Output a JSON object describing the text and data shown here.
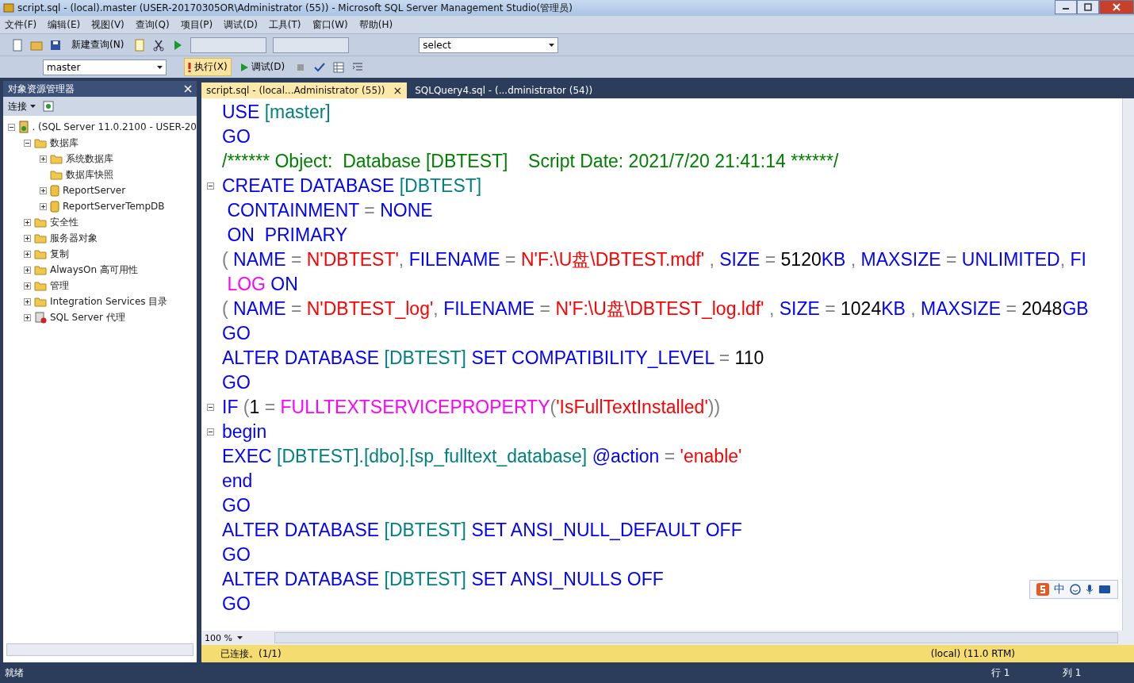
{
  "window": {
    "title": "script.sql - (local).master (USER-20170305OR\\Administrator (55)) - Microsoft SQL Server Management Studio(管理员)"
  },
  "menu": [
    "文件(F)",
    "编辑(E)",
    "视图(V)",
    "查询(Q)",
    "项目(P)",
    "调试(D)",
    "工具(T)",
    "窗口(W)",
    "帮助(H)"
  ],
  "toolbar": {
    "new_query": "新建查询(N)",
    "database": "master",
    "execute": "执行(X)",
    "debug": "调试(D)",
    "search_combo": "select"
  },
  "object_explorer": {
    "title": "对象资源管理器",
    "connect": "连接",
    "tree": [
      {
        "label": ". (SQL Server 11.0.2100 - USER-20",
        "kind": "server",
        "expanded": true,
        "children": [
          {
            "label": "数据库",
            "kind": "folder",
            "expanded": true,
            "children": [
              {
                "label": "系统数据库",
                "kind": "folder",
                "expanded": false
              },
              {
                "label": "数据库快照",
                "kind": "folder"
              },
              {
                "label": "ReportServer",
                "kind": "database",
                "expanded": false
              },
              {
                "label": "ReportServerTempDB",
                "kind": "database",
                "expanded": false
              }
            ]
          },
          {
            "label": "安全性",
            "kind": "folder",
            "expanded": false
          },
          {
            "label": "服务器对象",
            "kind": "folder",
            "expanded": false
          },
          {
            "label": "复制",
            "kind": "folder",
            "expanded": false
          },
          {
            "label": "AlwaysOn 高可用性",
            "kind": "folder",
            "expanded": false
          },
          {
            "label": "管理",
            "kind": "folder",
            "expanded": false
          },
          {
            "label": "Integration Services 目录",
            "kind": "folder",
            "expanded": false
          },
          {
            "label": "SQL Server 代理",
            "kind": "agent",
            "expanded": false
          }
        ]
      }
    ]
  },
  "tabs": [
    {
      "label": "script.sql - (local...Administrator (55))",
      "selected": true,
      "close": "×"
    },
    {
      "label": "SQLQuery4.sql - (...dministrator (54))",
      "selected": false
    }
  ],
  "code": [
    {
      "fold": false,
      "tokens": [
        {
          "kind": "kw",
          "t": "USE "
        },
        {
          "kind": "id",
          "t": "[master]"
        }
      ]
    },
    {
      "fold": false,
      "tokens": [
        {
          "kind": "kw",
          "t": "GO"
        }
      ]
    },
    {
      "fold": false,
      "tokens": [
        {
          "kind": "cm",
          "t": "/****** Object:  Database [DBTEST]    Script Date: 2021/7/20 21:41:14 ******/"
        }
      ]
    },
    {
      "fold": true,
      "tokens": [
        {
          "kind": "kw",
          "t": "CREATE DATABASE "
        },
        {
          "kind": "id",
          "t": "[DBTEST]"
        }
      ]
    },
    {
      "fold": false,
      "tokens": [
        {
          "kind": "kw",
          "t": " CONTAINMENT "
        },
        {
          "kind": "op",
          "t": "= "
        },
        {
          "kind": "kw",
          "t": "NONE"
        }
      ]
    },
    {
      "fold": false,
      "tokens": [
        {
          "kind": "kw",
          "t": " ON  PRIMARY"
        }
      ]
    },
    {
      "fold": false,
      "tokens": [
        {
          "kind": "op",
          "t": "( "
        },
        {
          "kind": "kw",
          "t": "NAME "
        },
        {
          "kind": "op",
          "t": "= "
        },
        {
          "kind": "str",
          "t": "N'DBTEST'"
        },
        {
          "kind": "op",
          "t": ", "
        },
        {
          "kind": "kw",
          "t": "FILENAME "
        },
        {
          "kind": "op",
          "t": "= "
        },
        {
          "kind": "str",
          "t": "N'F:\\U盘\\DBTEST.mdf'"
        },
        {
          "kind": "op",
          "t": " , "
        },
        {
          "kind": "kw",
          "t": "SIZE "
        },
        {
          "kind": "op",
          "t": "= "
        },
        {
          "kind": "num",
          "t": "5120"
        },
        {
          "kind": "kw",
          "t": "KB "
        },
        {
          "kind": "op",
          "t": ", "
        },
        {
          "kind": "kw",
          "t": "MAXSIZE "
        },
        {
          "kind": "op",
          "t": "= "
        },
        {
          "kind": "kw",
          "t": "UNLIMITED"
        },
        {
          "kind": "op",
          "t": ", "
        },
        {
          "kind": "kw",
          "t": "FI"
        }
      ]
    },
    {
      "fold": false,
      "tokens": [
        {
          "kind": "fn",
          "t": " LOG"
        },
        {
          "kind": "kw",
          "t": " ON"
        }
      ]
    },
    {
      "fold": false,
      "tokens": [
        {
          "kind": "op",
          "t": "( "
        },
        {
          "kind": "kw",
          "t": "NAME "
        },
        {
          "kind": "op",
          "t": "= "
        },
        {
          "kind": "str",
          "t": "N'DBTEST_log'"
        },
        {
          "kind": "op",
          "t": ", "
        },
        {
          "kind": "kw",
          "t": "FILENAME "
        },
        {
          "kind": "op",
          "t": "= "
        },
        {
          "kind": "str",
          "t": "N'F:\\U盘\\DBTEST_log.ldf'"
        },
        {
          "kind": "op",
          "t": " , "
        },
        {
          "kind": "kw",
          "t": "SIZE "
        },
        {
          "kind": "op",
          "t": "= "
        },
        {
          "kind": "num",
          "t": "1024"
        },
        {
          "kind": "kw",
          "t": "KB "
        },
        {
          "kind": "op",
          "t": ", "
        },
        {
          "kind": "kw",
          "t": "MAXSIZE "
        },
        {
          "kind": "op",
          "t": "= "
        },
        {
          "kind": "num",
          "t": "2048"
        },
        {
          "kind": "kw",
          "t": "GB"
        }
      ]
    },
    {
      "fold": false,
      "tokens": [
        {
          "kind": "kw",
          "t": "GO"
        }
      ]
    },
    {
      "fold": false,
      "tokens": [
        {
          "kind": "kw",
          "t": "ALTER DATABASE "
        },
        {
          "kind": "id",
          "t": "[DBTEST]"
        },
        {
          "kind": "kw",
          "t": " SET COMPATIBILITY_LEVEL "
        },
        {
          "kind": "op",
          "t": "= "
        },
        {
          "kind": "num",
          "t": "110"
        }
      ]
    },
    {
      "fold": false,
      "tokens": [
        {
          "kind": "kw",
          "t": "GO"
        }
      ]
    },
    {
      "fold": true,
      "tokens": [
        {
          "kind": "kw",
          "t": "IF "
        },
        {
          "kind": "op",
          "t": "("
        },
        {
          "kind": "num",
          "t": "1 "
        },
        {
          "kind": "op",
          "t": "= "
        },
        {
          "kind": "fn",
          "t": "FULLTEXTSERVICEPROPERTY"
        },
        {
          "kind": "op",
          "t": "("
        },
        {
          "kind": "str",
          "t": "'IsFullTextInstalled'"
        },
        {
          "kind": "op",
          "t": "))"
        }
      ]
    },
    {
      "fold": true,
      "tokens": [
        {
          "kind": "kw",
          "t": "begin"
        }
      ]
    },
    {
      "fold": false,
      "tokens": [
        {
          "kind": "kw",
          "t": "EXEC "
        },
        {
          "kind": "id",
          "t": "[DBTEST].[dbo].[sp_fulltext_database]"
        },
        {
          "kind": "kw",
          "t": " @action "
        },
        {
          "kind": "op",
          "t": "= "
        },
        {
          "kind": "str",
          "t": "'enable'"
        }
      ]
    },
    {
      "fold": false,
      "tokens": [
        {
          "kind": "kw",
          "t": "end"
        }
      ]
    },
    {
      "fold": false,
      "tokens": [
        {
          "kind": "kw",
          "t": "GO"
        }
      ]
    },
    {
      "fold": false,
      "tokens": [
        {
          "kind": "kw",
          "t": "ALTER DATABASE "
        },
        {
          "kind": "id",
          "t": "[DBTEST]"
        },
        {
          "kind": "kw",
          "t": " SET ANSI_NULL_DEFAULT OFF"
        }
      ]
    },
    {
      "fold": false,
      "tokens": [
        {
          "kind": "kw",
          "t": "GO"
        }
      ]
    },
    {
      "fold": false,
      "tokens": [
        {
          "kind": "kw",
          "t": "ALTER DATABASE "
        },
        {
          "kind": "id",
          "t": "[DBTEST]"
        },
        {
          "kind": "kw",
          "t": " SET ANSI_NULLS OFF"
        }
      ]
    },
    {
      "fold": false,
      "tokens": [
        {
          "kind": "kw",
          "t": "GO"
        }
      ]
    }
  ],
  "ime": {
    "mode": "中"
  },
  "editor_footer": {
    "zoom": "100 %"
  },
  "connection_bar": {
    "status": "已连接。(1/1)",
    "server": "(local) (11.0 RTM)"
  },
  "status_bar": {
    "left": "就绪",
    "line": "行 1",
    "column": "列 1"
  }
}
